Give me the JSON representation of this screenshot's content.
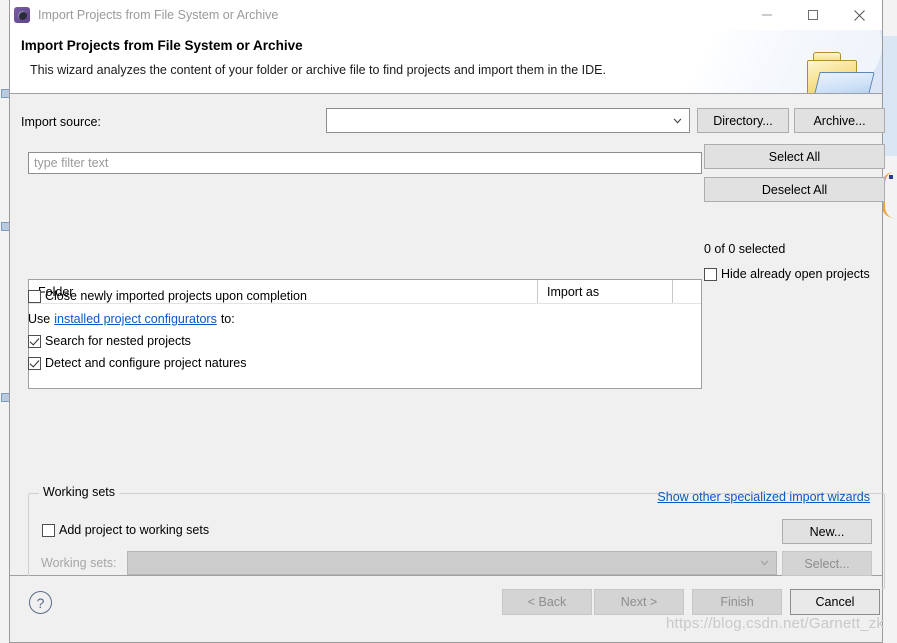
{
  "window": {
    "title": "Import Projects from File System or Archive",
    "app_icon": "eclipse-icon",
    "minimize_label": "—",
    "maximize_label": "□",
    "close_label": "✕"
  },
  "header": {
    "title": "Import Projects from File System or Archive",
    "description": "This wizard analyzes the content of your folder or archive file to find projects and import them in the IDE.",
    "icon": "folder-icon"
  },
  "source": {
    "label": "Import source:",
    "value": "",
    "placeholder": "",
    "directory_button": "Directory...",
    "archive_button": "Archive..."
  },
  "filter": {
    "value": "",
    "placeholder": "type filter text"
  },
  "tree": {
    "columns": [
      "Folder",
      "Import as"
    ],
    "rows": []
  },
  "selection": {
    "select_all": "Select All",
    "deselect_all": "Deselect All",
    "status": "0 of 0 selected",
    "hide_open_label": "Hide already open projects",
    "hide_open_checked": false
  },
  "options": {
    "close_imported": {
      "label": "Close newly imported projects upon completion",
      "checked": false
    },
    "configurators_prefix": "Use",
    "configurators_link": "installed project configurators",
    "configurators_suffix": "to:",
    "nested": {
      "label": "Search for nested projects",
      "checked": true
    },
    "natures": {
      "label": "Detect and configure project natures",
      "checked": true
    }
  },
  "working_sets": {
    "group_title": "Working sets",
    "add_label": "Add project to working sets",
    "add_checked": false,
    "combo_label": "Working sets:",
    "combo_value": "",
    "new_button": "New...",
    "select_button": "Select...",
    "combo_disabled": true,
    "select_disabled": true
  },
  "footer": {
    "other_wizards_link": "Show other specialized import wizards",
    "help_icon": "?",
    "back_button": "< Back",
    "next_button": "Next >",
    "finish_button": "Finish",
    "cancel_button": "Cancel",
    "back_disabled": true,
    "next_disabled": true,
    "finish_disabled": true
  },
  "watermark": "https://blog.csdn.net/Garnett_zk",
  "colors": {
    "dialog_bg": "#f0f0f0",
    "link": "#0b59c6",
    "border": "#9a9a9a",
    "button_bg": "#e1e1e1",
    "disabled_text": "#8d8d8d"
  }
}
